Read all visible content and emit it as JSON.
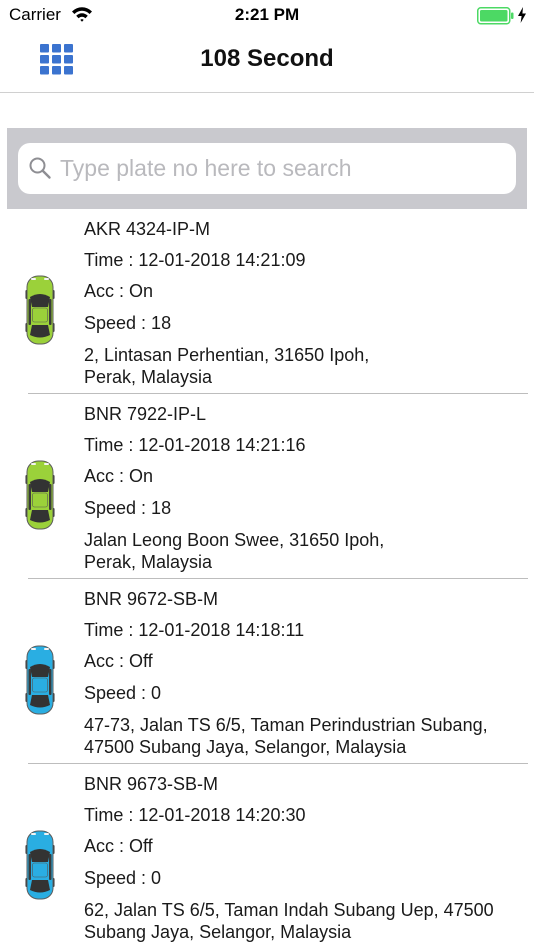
{
  "status_bar": {
    "carrier": "Carrier",
    "time": "2:21 PM"
  },
  "nav": {
    "title": "108 Second",
    "menu_icon": "grid-menu-icon"
  },
  "search": {
    "placeholder": "Type plate no here to search",
    "value": ""
  },
  "colors": {
    "online": "#9bd13a",
    "offline": "#2aaee2",
    "separator": "#bdbdbd",
    "search_bg": "#c9c9ce"
  },
  "vehicles": [
    {
      "plate": "AKR 4324-IP-M",
      "time": "Time : 12-01-2018 14:21:09",
      "acc": "Acc : On",
      "speed": "Speed : 18",
      "address_line1": "2, Lintasan Perhentian, 31650 Ipoh,",
      "address_line2": "Perak, Malaysia",
      "car_color": "#9bd13a"
    },
    {
      "plate": "BNR 7922-IP-L",
      "time": "Time : 12-01-2018 14:21:16",
      "acc": "Acc : On",
      "speed": "Speed : 18",
      "address_line1": "Jalan Leong Boon Swee, 31650 Ipoh,",
      "address_line2": "Perak, Malaysia",
      "car_color": "#9bd13a"
    },
    {
      "plate": "BNR 9672-SB-M",
      "time": "Time : 12-01-2018 14:18:11",
      "acc": "Acc : Off",
      "speed": "Speed : 0",
      "address_line1": "47-73, Jalan TS 6/5, Taman Perindustrian Subang,",
      "address_line2": "47500 Subang Jaya, Selangor, Malaysia",
      "car_color": "#2aaee2"
    },
    {
      "plate": "BNR 9673-SB-M",
      "time": "Time : 12-01-2018 14:20:30",
      "acc": "Acc : Off",
      "speed": "Speed : 0",
      "address_line1": "62, Jalan TS 6/5, Taman Indah Subang Uep, 47500",
      "address_line2": "Subang Jaya, Selangor, Malaysia",
      "car_color": "#2aaee2"
    }
  ]
}
